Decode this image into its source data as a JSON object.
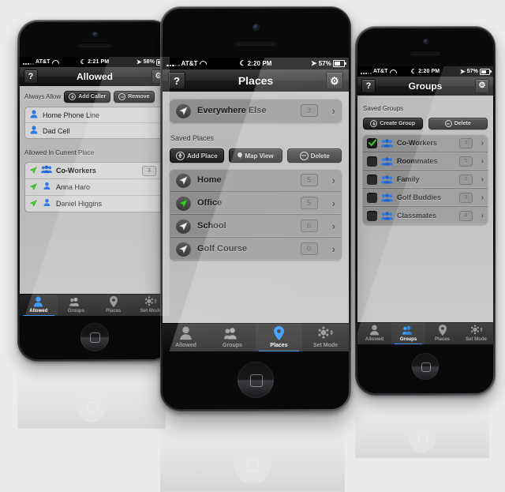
{
  "background_color": "#ebebeb",
  "accent_color": "#1a8cff",
  "phones": [
    {
      "id": "left",
      "status_bar": {
        "carrier": "AT&T",
        "signal_icon": "signal-dots-icon",
        "wifi_icon": "wifi-icon",
        "dnd_icon": "moon-icon",
        "time": "2:21 PM",
        "location_icon": "location-arrow-icon",
        "battery_percent": "58%",
        "battery_icon": "battery-icon"
      },
      "nav": {
        "left_button": "?",
        "title": "Allowed",
        "right_icon": "gear-icon"
      },
      "sections": [
        {
          "label": "Always Allow",
          "buttons": [
            {
              "label": "Add Caller",
              "icon": "plus-circle-icon"
            },
            {
              "label": "Remove",
              "icon": "minus-circle-icon"
            }
          ],
          "list_style": "white",
          "rows": [
            {
              "icon": "person-icon",
              "name": "Home Phone Line"
            },
            {
              "icon": "person-icon",
              "name": "Dad Cell"
            }
          ]
        },
        {
          "label": "Allowed In Current Place",
          "buttons": [],
          "list_style": "white",
          "rows": [
            {
              "arrow": "location-arrow-green-icon",
              "icon": "group-icon",
              "name": "Co-Workers",
              "badge": "3",
              "bold": true
            },
            {
              "arrow": "location-arrow-green-icon",
              "icon": "person-icon",
              "name": "Anna Haro"
            },
            {
              "arrow": "location-arrow-green-icon",
              "icon": "person-icon",
              "name": "Daniel Higgins"
            }
          ]
        }
      ],
      "tabs": [
        {
          "label": "Allowed",
          "icon": "person-icon",
          "active": true
        },
        {
          "label": "Groups",
          "icon": "group-icon",
          "active": false
        },
        {
          "label": "Places",
          "icon": "pin-icon",
          "active": false
        },
        {
          "label": "Set Mode",
          "icon": "mode-dots-icon",
          "active": false
        }
      ]
    },
    {
      "id": "center",
      "status_bar": {
        "carrier": "AT&T",
        "signal_icon": "signal-dots-icon",
        "wifi_icon": "wifi-icon",
        "dnd_icon": "moon-icon",
        "time": "2:20 PM",
        "location_icon": "location-arrow-icon",
        "battery_percent": "57%",
        "battery_icon": "battery-icon"
      },
      "nav": {
        "left_button": "?",
        "title": "Places",
        "right_icon": "gear-icon"
      },
      "top_row": {
        "arrow": "location-arrow-icon",
        "name": "Everywhere Else",
        "badge": "3"
      },
      "sections": [
        {
          "label": "Saved Places",
          "buttons": [
            {
              "label": "Add Place",
              "icon": "plus-circle-icon"
            },
            {
              "label": "Map View",
              "icon": "pin-icon"
            },
            {
              "label": "Delete",
              "icon": "minus-circle-icon"
            }
          ],
          "list_style": "gray",
          "rows": [
            {
              "arrow": "location-arrow-icon",
              "name": "Home",
              "badge": "5"
            },
            {
              "arrow": "location-arrow-green-icon",
              "name": "Office",
              "badge": "5"
            },
            {
              "arrow": "location-arrow-icon",
              "name": "School",
              "badge": "6"
            },
            {
              "arrow": "location-arrow-icon",
              "name": "Golf Course",
              "badge": "0"
            }
          ]
        }
      ],
      "tabs": [
        {
          "label": "Allowed",
          "icon": "person-icon",
          "active": false
        },
        {
          "label": "Groups",
          "icon": "group-icon",
          "active": false
        },
        {
          "label": "Places",
          "icon": "pin-icon",
          "active": true
        },
        {
          "label": "Set Mode",
          "icon": "mode-dots-icon",
          "active": false
        }
      ]
    },
    {
      "id": "right",
      "status_bar": {
        "carrier": "AT&T",
        "signal_icon": "signal-dots-icon",
        "wifi_icon": "wifi-icon",
        "dnd_icon": "moon-icon",
        "time": "2:20 PM",
        "location_icon": "location-arrow-icon",
        "battery_percent": "57%",
        "battery_icon": "battery-icon"
      },
      "nav": {
        "left_button": "?",
        "title": "Groups",
        "right_icon": "gear-icon"
      },
      "sections": [
        {
          "label": "Saved Groups",
          "buttons": [
            {
              "label": "Create Group",
              "icon": "plus-circle-icon"
            },
            {
              "label": "Delete",
              "icon": "minus-circle-icon"
            }
          ],
          "list_style": "gray",
          "rows": [
            {
              "checkbox": "checked",
              "icon": "group-icon",
              "name": "Co-Workers",
              "badge": "3"
            },
            {
              "checkbox": "unchecked",
              "icon": "group-icon",
              "name": "Roommates",
              "badge": "5"
            },
            {
              "checkbox": "unchecked",
              "icon": "group-icon",
              "name": "Family",
              "badge": "8"
            },
            {
              "checkbox": "unchecked",
              "icon": "group-icon",
              "name": "Golf Buddies",
              "badge": "3"
            },
            {
              "checkbox": "unchecked",
              "icon": "group-icon",
              "name": "Classmates",
              "badge": "4"
            }
          ]
        }
      ],
      "tabs": [
        {
          "label": "Allowed",
          "icon": "person-icon",
          "active": false
        },
        {
          "label": "Groups",
          "icon": "group-icon",
          "active": true
        },
        {
          "label": "Places",
          "icon": "pin-icon",
          "active": false
        },
        {
          "label": "Set Mode",
          "icon": "mode-dots-icon",
          "active": false
        }
      ]
    }
  ]
}
